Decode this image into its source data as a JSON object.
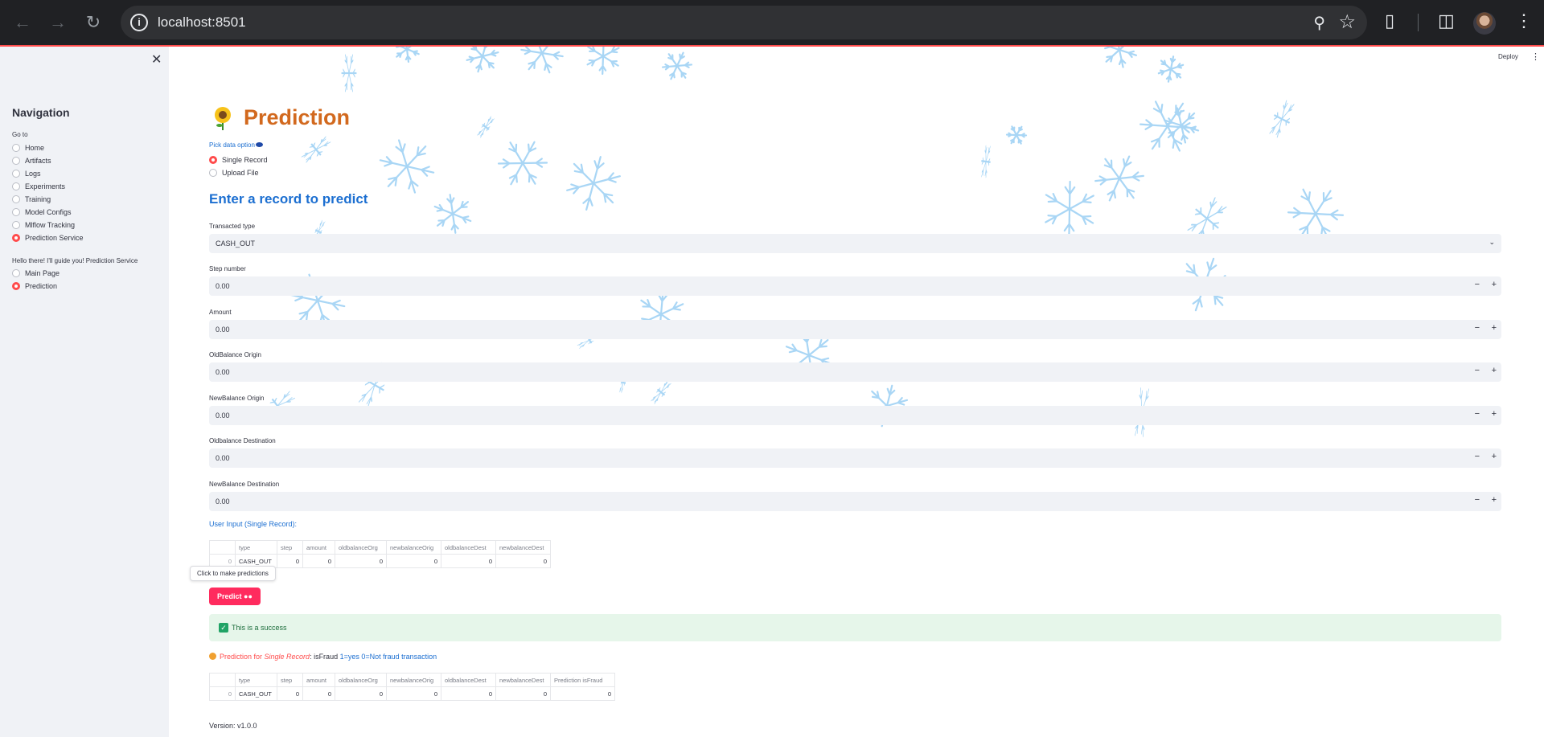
{
  "browser": {
    "url": "localhost:8501",
    "icons": [
      "back-icon",
      "forward-icon",
      "reload-icon",
      "info-icon",
      "zoom-icon",
      "star-icon",
      "extensions-icon",
      "sidepanel-icon",
      "avatar",
      "kebab-icon"
    ]
  },
  "header": {
    "deploy_label": "Deploy"
  },
  "sidebar": {
    "title": "Navigation",
    "goto_caption": "Go to",
    "items": [
      {
        "label": "Home",
        "selected": false
      },
      {
        "label": "Artifacts",
        "selected": false
      },
      {
        "label": "Logs",
        "selected": false
      },
      {
        "label": "Experiments",
        "selected": false
      },
      {
        "label": "Training",
        "selected": false
      },
      {
        "label": "Model Configs",
        "selected": false
      },
      {
        "label": "Mlflow Tracking",
        "selected": false
      },
      {
        "label": "Prediction Service",
        "selected": true
      }
    ],
    "guide_caption": "Hello there! I'll guide you! Prediction Service",
    "pages": [
      {
        "label": "Main Page",
        "selected": false
      },
      {
        "label": "Prediction",
        "selected": true
      }
    ]
  },
  "main": {
    "title": "Prediction",
    "pick_label": "Pick data option",
    "options": [
      {
        "label": "Single Record",
        "selected": true
      },
      {
        "label": "Upload File",
        "selected": false
      }
    ],
    "subheader": "Enter a record to predict",
    "fields": {
      "type": {
        "label": "Transacted type",
        "value": "CASH_OUT"
      },
      "step": {
        "label": "Step number",
        "value": "0.00"
      },
      "amount": {
        "label": "Amount",
        "value": "0.00"
      },
      "old_orig": {
        "label": "OldBalance Origin",
        "value": "0.00"
      },
      "new_orig": {
        "label": "NewBalance Origin",
        "value": "0.00"
      },
      "old_dest": {
        "label": "Oldbalance Destination",
        "value": "0.00"
      },
      "new_dest": {
        "label": "NewBalance Destination",
        "value": "0.00"
      }
    },
    "stepper": {
      "minus": "−",
      "plus": "+"
    },
    "user_input_label": "User Input (Single Record):",
    "input_table": {
      "columns": [
        "",
        "type",
        "step",
        "amount",
        "oldbalanceOrg",
        "newbalanceOrig",
        "oldbalanceDest",
        "newbalanceDest"
      ],
      "row": [
        "0",
        "CASH_OUT",
        "0",
        "0",
        "0",
        "0",
        "0",
        "0"
      ]
    },
    "tooltip": "Click to make predictions",
    "predict_label": "Predict",
    "success_text": "This is a success",
    "prediction_line": {
      "prefix": "Prediction for ",
      "italic": "Single Record",
      "middle": ": isFraud ",
      "legend": "1=yes 0=Not fraud transaction"
    },
    "output_table": {
      "columns": [
        "",
        "type",
        "step",
        "amount",
        "oldbalanceOrg",
        "newbalanceOrig",
        "oldbalanceDest",
        "newbalanceDest",
        "Prediction isFraud"
      ],
      "row": [
        "0",
        "CASH_OUT",
        "0",
        "0",
        "0",
        "0",
        "0",
        "0",
        "0"
      ]
    },
    "version": "Version: v1.0.0"
  },
  "colors": {
    "accent": "#ff4b4b",
    "title": "#d2691e",
    "link_blue": "#1c6fd1",
    "button": "#ff2b5e",
    "success_bg": "#e6f6ea",
    "snowflake": "#a9d6f5"
  }
}
